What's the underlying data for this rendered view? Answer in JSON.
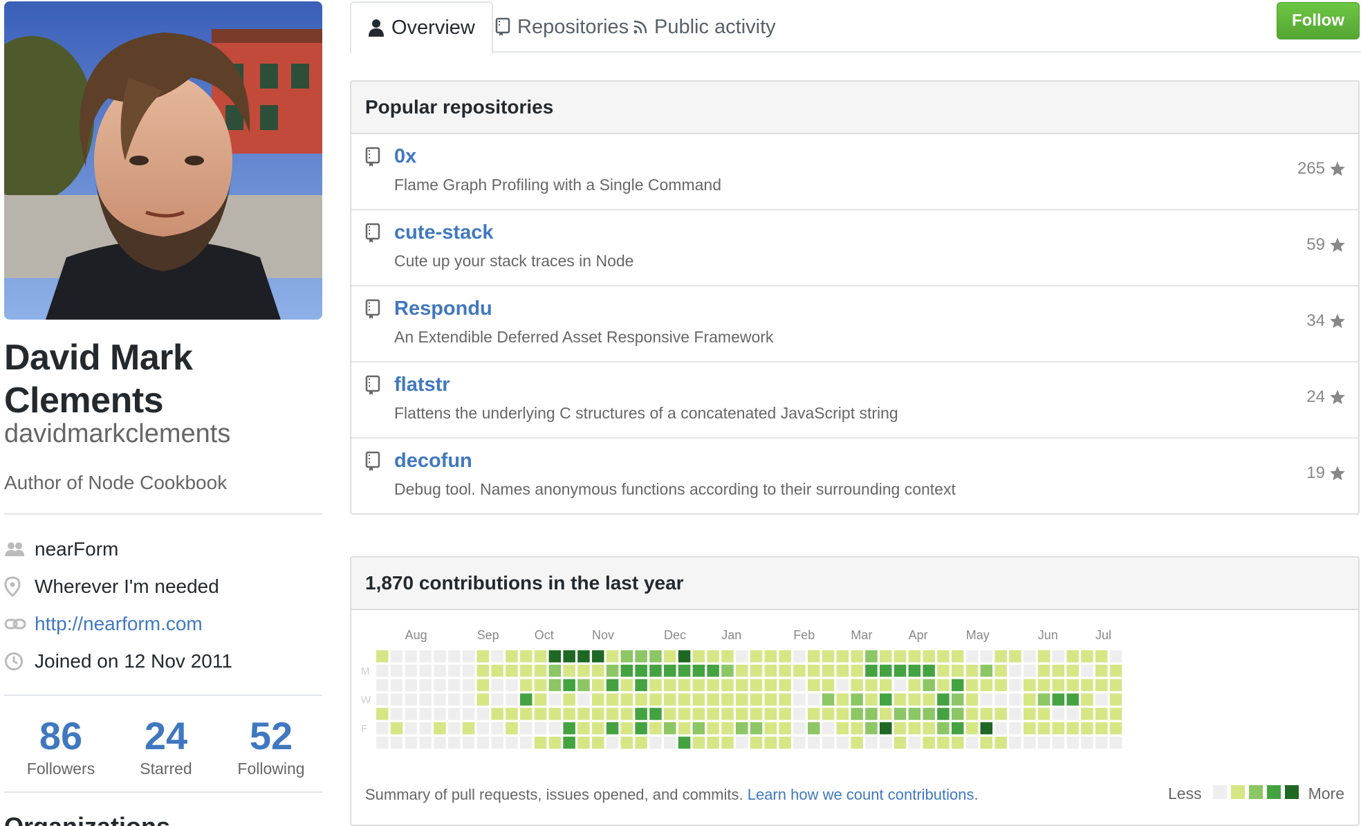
{
  "profile": {
    "name": "David Mark Clements",
    "username": "davidmarkclements",
    "bio": "Author of Node Cookbook",
    "company": "nearForm",
    "location": "Wherever I'm needed",
    "website": "http://nearform.com",
    "joined": "Joined on 12 Nov 2011",
    "icons": {
      "company": "people-icon",
      "location": "location-pin-icon",
      "website": "link-icon",
      "joined": "clock-icon"
    }
  },
  "stats": [
    {
      "value": "86",
      "label": "Followers"
    },
    {
      "value": "24",
      "label": "Starred"
    },
    {
      "value": "52",
      "label": "Following"
    }
  ],
  "organizations_heading": "Organizations",
  "tabs": [
    {
      "label": "Overview",
      "icon": "person-icon",
      "selected": true
    },
    {
      "label": "Repositories",
      "icon": "repo-icon",
      "selected": false
    },
    {
      "label": "Public activity",
      "icon": "rss-icon",
      "selected": false
    }
  ],
  "follow_label": "Follow",
  "popular": {
    "heading": "Popular repositories",
    "repos": [
      {
        "name": "0x",
        "description": "Flame Graph Profiling with a Single Command",
        "stars": "265"
      },
      {
        "name": "cute-stack",
        "description": "Cute up your stack traces in Node",
        "stars": "59"
      },
      {
        "name": "Respondu",
        "description": "An Extendible Deferred Asset Responsive Framework",
        "stars": "34"
      },
      {
        "name": "flatstr",
        "description": "Flattens the underlying C structures of a concatenated JavaScript string",
        "stars": "24"
      },
      {
        "name": "decofun",
        "description": "Debug tool. Names anonymous functions according to their surrounding context",
        "stars": "19"
      }
    ]
  },
  "contributions": {
    "heading": "1,870 contributions in the last year",
    "months": [
      {
        "label": "Aug",
        "week": 2
      },
      {
        "label": "Sep",
        "week": 7
      },
      {
        "label": "Oct",
        "week": 11
      },
      {
        "label": "Nov",
        "week": 15
      },
      {
        "label": "Dec",
        "week": 20
      },
      {
        "label": "Jan",
        "week": 24
      },
      {
        "label": "Feb",
        "week": 29
      },
      {
        "label": "Mar",
        "week": 33
      },
      {
        "label": "Apr",
        "week": 37
      },
      {
        "label": "May",
        "week": 41
      },
      {
        "label": "Jun",
        "week": 46
      },
      {
        "label": "Jul",
        "week": 50
      }
    ],
    "day_labels": [
      {
        "label": "M",
        "row": 1
      },
      {
        "label": "W",
        "row": 3
      },
      {
        "label": "F",
        "row": 5
      }
    ],
    "colors": [
      "#eeeeee",
      "#d6e685",
      "#8cc665",
      "#44a340",
      "#1e6823"
    ],
    "grid": [
      "1000000101114444122214111011101111211111100110101110",
      "0000000111112111233333332111111111333331112100111011",
      "0000000100112321313111111111101101110121311101111111",
      "0000000100310101111111111111100212131113210001233101",
      "1000000011111111113311111111101112212223211101100111",
      "0100101001000311313121211221102011241112314001111111",
      "0000000000011311011003111011100001001011101100000000"
    ],
    "footer_text": "Summary of pull requests, issues opened, and commits.",
    "footer_link": "Learn how we count contributions",
    "footer_period": ".",
    "legend_less": "Less",
    "legend_more": "More"
  }
}
